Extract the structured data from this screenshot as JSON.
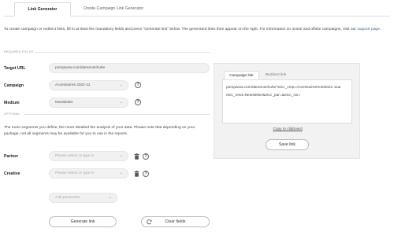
{
  "tabs": {
    "link_generator": "Link Generator",
    "onsite_campaign": "Onsite-Campaign Link Generator"
  },
  "intro": {
    "text": "To create campaign or redirect links, fill in at least the mandatory fields and press \"Generate link\" below. The generated links then appear on the right. For information on onsite and offsite campaigns, visit our ",
    "link_label": "support page",
    "suffix": "."
  },
  "sections": {
    "required": "REQUIRED FIELDS",
    "optional": "OPTIONAL"
  },
  "fields": {
    "target_url": {
      "label": "Target URL",
      "value": "pompwow.com/damenschuhe"
    },
    "campaign": {
      "label": "Campaign",
      "value": "Accessoires 2021-11"
    },
    "medium": {
      "label": "Medium",
      "value": "Newsletter"
    },
    "partner": {
      "label": "Partner",
      "placeholder": "Please select or type in"
    },
    "creative": {
      "label": "Creative",
      "placeholder": "Please select or type in"
    },
    "add_parameter": {
      "placeholder": "Add parameter"
    }
  },
  "optional_description": "The more segments you define, the more detailed the analysis of your data. Please note that depending on your package, not all segments may be available for you to use in the reports.",
  "buttons": {
    "generate": "Generate link",
    "clear": "Clear fields",
    "save": "Save link",
    "copy": "Copy to clipboard"
  },
  "output": {
    "tab_campaign": "Campaign link",
    "tab_redirect": "Redirect link",
    "line1": "pompwow.com/damenschuhe?etcc_cmp=Accessoires%202021-11&",
    "line2": "etcc_med=Newsletter&etcc_par=&etcc_ctv="
  },
  "icons": {
    "help": "question-circle-icon",
    "chevron": "chevron-down-icon",
    "trash": "trash-icon",
    "refresh": "refresh-icon"
  },
  "colors": {
    "link": "#2a6ebb",
    "panel_bg": "#f2f2f2",
    "input_bg": "#f1f1f1"
  }
}
